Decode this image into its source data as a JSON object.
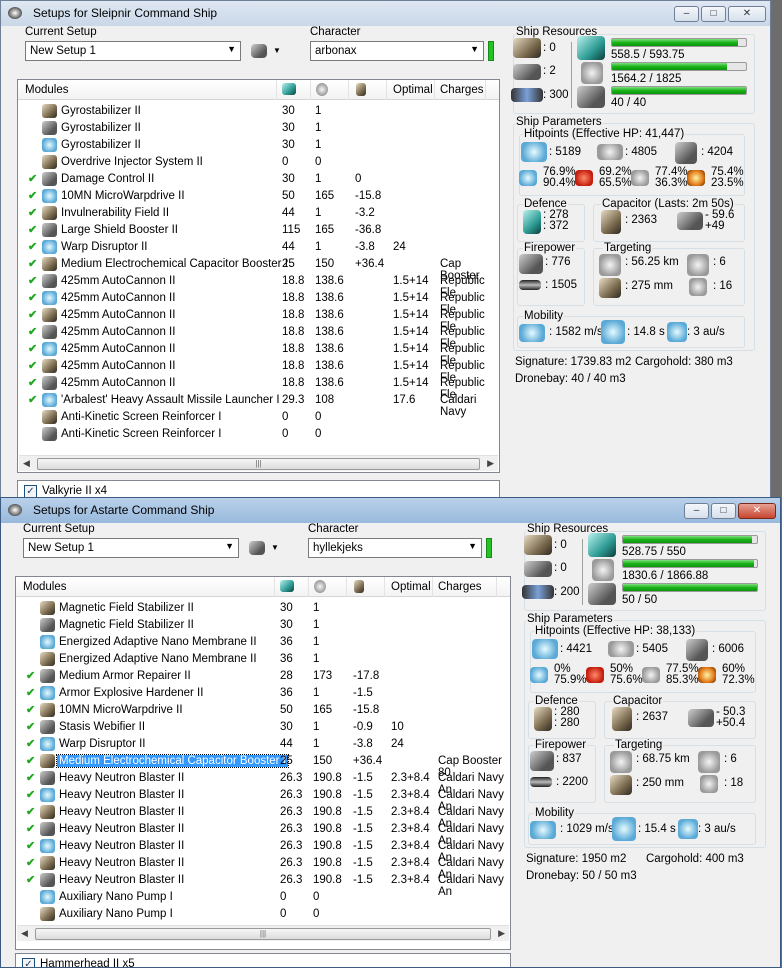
{
  "windows": [
    {
      "title": "Setups for Sleipnir Command Ship",
      "current_setup_label": "Current Setup",
      "setup_value": "New Setup 1",
      "character_label": "Character",
      "character_value": "arbonax",
      "columns": {
        "modules": "Modules",
        "optimal": "Optimal",
        "charges": "Charges"
      },
      "modules": [
        {
          "checked": false,
          "name": "Gyrostabilizer II",
          "cpu": "30",
          "pg": "1",
          "cap": "",
          "optimal": "",
          "charges": ""
        },
        {
          "checked": false,
          "name": "Gyrostabilizer II",
          "cpu": "30",
          "pg": "1",
          "cap": "",
          "optimal": "",
          "charges": ""
        },
        {
          "checked": false,
          "name": "Gyrostabilizer II",
          "cpu": "30",
          "pg": "1",
          "cap": "",
          "optimal": "",
          "charges": ""
        },
        {
          "checked": false,
          "name": "Overdrive Injector System II",
          "cpu": "0",
          "pg": "0",
          "cap": "",
          "optimal": "",
          "charges": ""
        },
        {
          "checked": true,
          "name": "Damage Control II",
          "cpu": "30",
          "pg": "1",
          "cap": "0",
          "optimal": "",
          "charges": ""
        },
        {
          "checked": true,
          "name": "10MN MicroWarpdrive II",
          "cpu": "50",
          "pg": "165",
          "cap": "-15.8",
          "optimal": "",
          "charges": ""
        },
        {
          "checked": true,
          "name": "Invulnerability Field II",
          "cpu": "44",
          "pg": "1",
          "cap": "-3.2",
          "optimal": "",
          "charges": ""
        },
        {
          "checked": true,
          "name": "Large Shield Booster II",
          "cpu": "115",
          "pg": "165",
          "cap": "-36.8",
          "optimal": "",
          "charges": ""
        },
        {
          "checked": true,
          "name": "Warp Disruptor II",
          "cpu": "44",
          "pg": "1",
          "cap": "-3.8",
          "optimal": "24",
          "charges": ""
        },
        {
          "checked": true,
          "name": "Medium Electrochemical Capacitor Booster I",
          "cpu": "25",
          "pg": "150",
          "cap": "+36.4",
          "optimal": "",
          "charges": "Cap Booster"
        },
        {
          "checked": true,
          "name": "425mm AutoCannon II",
          "cpu": "18.8",
          "pg": "138.6",
          "cap": "",
          "optimal": "1.5+14",
          "charges": "Republic Fle"
        },
        {
          "checked": true,
          "name": "425mm AutoCannon II",
          "cpu": "18.8",
          "pg": "138.6",
          "cap": "",
          "optimal": "1.5+14",
          "charges": "Republic Fle"
        },
        {
          "checked": true,
          "name": "425mm AutoCannon II",
          "cpu": "18.8",
          "pg": "138.6",
          "cap": "",
          "optimal": "1.5+14",
          "charges": "Republic Fle"
        },
        {
          "checked": true,
          "name": "425mm AutoCannon II",
          "cpu": "18.8",
          "pg": "138.6",
          "cap": "",
          "optimal": "1.5+14",
          "charges": "Republic Fle"
        },
        {
          "checked": true,
          "name": "425mm AutoCannon II",
          "cpu": "18.8",
          "pg": "138.6",
          "cap": "",
          "optimal": "1.5+14",
          "charges": "Republic Fle"
        },
        {
          "checked": true,
          "name": "425mm AutoCannon II",
          "cpu": "18.8",
          "pg": "138.6",
          "cap": "",
          "optimal": "1.5+14",
          "charges": "Republic Fle"
        },
        {
          "checked": true,
          "name": "425mm AutoCannon II",
          "cpu": "18.8",
          "pg": "138.6",
          "cap": "",
          "optimal": "1.5+14",
          "charges": "Republic Fle"
        },
        {
          "checked": true,
          "name": "'Arbalest' Heavy Assault Missile Launcher I",
          "cpu": "29.3",
          "pg": "108",
          "cap": "",
          "optimal": "17.6",
          "charges": "Caldari Navy"
        },
        {
          "checked": false,
          "name": "Anti-Kinetic Screen Reinforcer I",
          "cpu": "0",
          "pg": "0",
          "cap": "",
          "optimal": "",
          "charges": ""
        },
        {
          "checked": false,
          "name": "Anti-Kinetic Screen Reinforcer I",
          "cpu": "0",
          "pg": "0",
          "cap": "",
          "optimal": "",
          "charges": ""
        }
      ],
      "drones": "Valkyrie II x4",
      "resources": {
        "label": "Ship Resources",
        "turrets": ": 0",
        "launchers": ": 2",
        "drone_bandwidth": ": 300",
        "cpu": "558.5 / 593.75",
        "cpu_fraction": 0.94,
        "powergrid": "1564.2 / 1825",
        "powergrid_fraction": 0.857,
        "drone_bay_bw": "40 / 40",
        "drone_bay_bw_fraction": 1.0
      },
      "params": {
        "label": "Ship Parameters",
        "hitpoints_label": "Hitpoints (Effective HP: 41,447)",
        "shield": ": 5189",
        "armor": ": 4805",
        "hull": ": 4204",
        "resists": {
          "em": [
            "76.9%",
            "90.4%"
          ],
          "thermal": [
            "69.2%",
            "65.5%"
          ],
          "kinetic": [
            "77.4%",
            "36.3%"
          ],
          "explosive": [
            "75.4%",
            "23.5%"
          ]
        },
        "defence_label": "Defence",
        "defence": [
          ": 278",
          ": 372"
        ],
        "capacitor_label": "Capacitor (Lasts: 2m 50s)",
        "capacitor": ": 2363",
        "cap_rate": [
          "- 59.6",
          "+49"
        ],
        "firepower_label": "Firepower",
        "dps": ": 776",
        "volley": ": 1505",
        "targeting_label": "Targeting",
        "range": ": 56.25 km",
        "max_targets": ": 6",
        "scan_res": ": 275 mm",
        "sensor": ": 16",
        "mobility_label": "Mobility",
        "speed": ": 1582 m/s",
        "align": ": 14.8 s",
        "warp": ": 3 au/s",
        "signature": "Signature: 1739.83 m2",
        "cargohold": "Cargohold: 380 m3",
        "dronebay": "Dronebay: 40 / 40 m3"
      }
    },
    {
      "title": "Setups for Astarte Command Ship",
      "current_setup_label": "Current Setup",
      "setup_value": "New Setup 1",
      "character_label": "Character",
      "character_value": "hyllekjeks",
      "columns": {
        "modules": "Modules",
        "optimal": "Optimal",
        "charges": "Charges"
      },
      "modules": [
        {
          "checked": false,
          "name": "Magnetic Field Stabilizer II",
          "cpu": "30",
          "pg": "1",
          "cap": "",
          "optimal": "",
          "charges": ""
        },
        {
          "checked": false,
          "name": "Magnetic Field Stabilizer II",
          "cpu": "30",
          "pg": "1",
          "cap": "",
          "optimal": "",
          "charges": ""
        },
        {
          "checked": false,
          "name": "Energized Adaptive Nano Membrane II",
          "cpu": "36",
          "pg": "1",
          "cap": "",
          "optimal": "",
          "charges": ""
        },
        {
          "checked": false,
          "name": "Energized Adaptive Nano Membrane II",
          "cpu": "36",
          "pg": "1",
          "cap": "",
          "optimal": "",
          "charges": ""
        },
        {
          "checked": true,
          "name": "Medium Armor Repairer II",
          "cpu": "28",
          "pg": "173",
          "cap": "-17.8",
          "optimal": "",
          "charges": ""
        },
        {
          "checked": true,
          "name": "Armor Explosive Hardener II",
          "cpu": "36",
          "pg": "1",
          "cap": "-1.5",
          "optimal": "",
          "charges": ""
        },
        {
          "checked": true,
          "name": "10MN MicroWarpdrive II",
          "cpu": "50",
          "pg": "165",
          "cap": "-15.8",
          "optimal": "",
          "charges": ""
        },
        {
          "checked": true,
          "name": "Stasis Webifier II",
          "cpu": "30",
          "pg": "1",
          "cap": "-0.9",
          "optimal": "10",
          "charges": ""
        },
        {
          "checked": true,
          "name": "Warp Disruptor II",
          "cpu": "44",
          "pg": "1",
          "cap": "-3.8",
          "optimal": "24",
          "charges": ""
        },
        {
          "checked": true,
          "name": "Medium Electrochemical Capacitor Booster I",
          "cpu": "25",
          "pg": "150",
          "cap": "+36.4",
          "optimal": "",
          "charges": "Cap Booster 80",
          "selected": true
        },
        {
          "checked": true,
          "name": "Heavy Neutron Blaster II",
          "cpu": "26.3",
          "pg": "190.8",
          "cap": "-1.5",
          "optimal": "2.3+8.4",
          "charges": "Caldari Navy An"
        },
        {
          "checked": true,
          "name": "Heavy Neutron Blaster II",
          "cpu": "26.3",
          "pg": "190.8",
          "cap": "-1.5",
          "optimal": "2.3+8.4",
          "charges": "Caldari Navy An"
        },
        {
          "checked": true,
          "name": "Heavy Neutron Blaster II",
          "cpu": "26.3",
          "pg": "190.8",
          "cap": "-1.5",
          "optimal": "2.3+8.4",
          "charges": "Caldari Navy An"
        },
        {
          "checked": true,
          "name": "Heavy Neutron Blaster II",
          "cpu": "26.3",
          "pg": "190.8",
          "cap": "-1.5",
          "optimal": "2.3+8.4",
          "charges": "Caldari Navy An"
        },
        {
          "checked": true,
          "name": "Heavy Neutron Blaster II",
          "cpu": "26.3",
          "pg": "190.8",
          "cap": "-1.5",
          "optimal": "2.3+8.4",
          "charges": "Caldari Navy An"
        },
        {
          "checked": true,
          "name": "Heavy Neutron Blaster II",
          "cpu": "26.3",
          "pg": "190.8",
          "cap": "-1.5",
          "optimal": "2.3+8.4",
          "charges": "Caldari Navy An"
        },
        {
          "checked": true,
          "name": "Heavy Neutron Blaster II",
          "cpu": "26.3",
          "pg": "190.8",
          "cap": "-1.5",
          "optimal": "2.3+8.4",
          "charges": "Caldari Navy An"
        },
        {
          "checked": false,
          "name": "Auxiliary Nano Pump I",
          "cpu": "0",
          "pg": "0",
          "cap": "",
          "optimal": "",
          "charges": ""
        },
        {
          "checked": false,
          "name": "Auxiliary Nano Pump I",
          "cpu": "0",
          "pg": "0",
          "cap": "",
          "optimal": "",
          "charges": ""
        }
      ],
      "drones": "Hammerhead II x5",
      "resources": {
        "label": "Ship Resources",
        "turrets": ": 0",
        "launchers": ": 0",
        "drone_bandwidth": ": 200",
        "cpu": "528.75 / 550",
        "cpu_fraction": 0.961,
        "powergrid": "1830.6 / 1866.88",
        "powergrid_fraction": 0.98,
        "drone_bay_bw": "50 / 50",
        "drone_bay_bw_fraction": 1.0
      },
      "params": {
        "label": "Ship Parameters",
        "hitpoints_label": "Hitpoints (Effective HP: 38,133)",
        "shield": ": 4421",
        "armor": ": 5405",
        "hull": ": 6006",
        "resists": {
          "em": [
            "0%",
            "75.9%"
          ],
          "thermal": [
            "50%",
            "75.6%"
          ],
          "kinetic": [
            "77.5%",
            "85.3%"
          ],
          "explosive": [
            "60%",
            "72.3%"
          ]
        },
        "defence_label": "Defence",
        "defence": [
          ": 280",
          ": 280"
        ],
        "capacitor_label": "Capacitor",
        "capacitor": ": 2637",
        "cap_rate": [
          "- 50.3",
          "+50.4"
        ],
        "firepower_label": "Firepower",
        "dps": ": 837",
        "volley": ": 2200",
        "targeting_label": "Targeting",
        "range": ": 68.75 km",
        "max_targets": ": 6",
        "scan_res": ": 250 mm",
        "sensor": ": 18",
        "mobility_label": "Mobility",
        "speed": ": 1029 m/s",
        "align": ": 15.4 s",
        "warp": ": 3 au/s",
        "signature": "Signature: 1950 m2",
        "cargohold": "Cargohold: 400 m3",
        "dronebay": "Dronebay: 50 / 50 m3"
      }
    }
  ]
}
